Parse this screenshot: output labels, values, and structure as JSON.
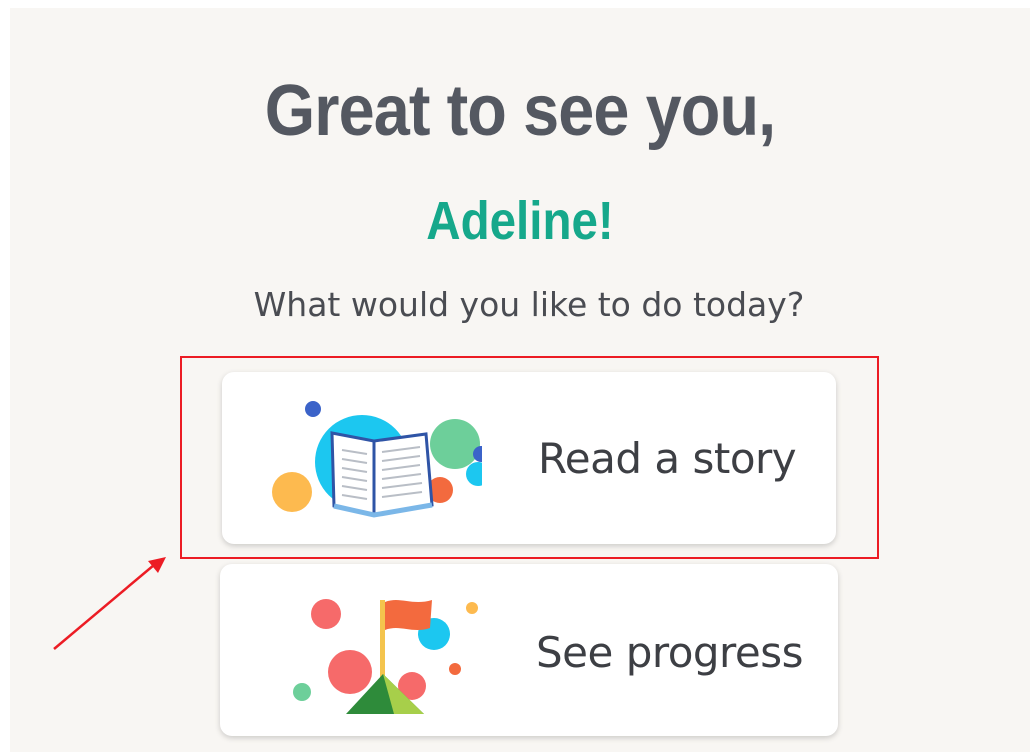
{
  "header": {
    "greeting": "Great to see you,",
    "name": "Adeline!",
    "prompt": "What would you like to do today?"
  },
  "options": [
    {
      "label": "Read a story",
      "icon": "book-icon"
    },
    {
      "label": "See progress",
      "icon": "flag-icon"
    }
  ],
  "colors": {
    "background": "#f8f6f3",
    "greeting": "#545861",
    "name": "#16a88b",
    "annotation": "#ec1c24"
  }
}
